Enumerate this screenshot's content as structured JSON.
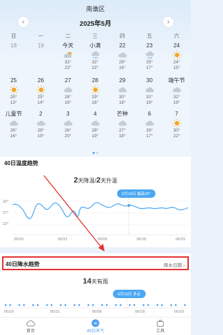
{
  "header": {
    "city": "南谯区",
    "month_title": "2025年5月",
    "prev": "‹",
    "next": "›"
  },
  "weekdays": [
    "日",
    "一",
    "二",
    "三",
    "四",
    "五",
    "六"
  ],
  "days": [
    {
      "d": "18",
      "hi": "",
      "lo": "",
      "icon": "none",
      "past": true
    },
    {
      "d": "19",
      "hi": "",
      "lo": "",
      "icon": "none",
      "past": true
    },
    {
      "d": "今天",
      "hi": "32°",
      "lo": "22°",
      "icon": "cloud-sun",
      "past": false
    },
    {
      "d": "小满",
      "hi": "32°",
      "lo": "22°",
      "icon": "rain",
      "past": false
    },
    {
      "d": "22",
      "hi": "29°",
      "lo": "16°",
      "icon": "cloud",
      "past": false
    },
    {
      "d": "23",
      "hi": "25°",
      "lo": "17°",
      "icon": "rain",
      "past": false
    },
    {
      "d": "24",
      "hi": "24°",
      "lo": "15°",
      "icon": "sun",
      "past": false
    },
    {
      "d": "25",
      "hi": "25°",
      "lo": "13°",
      "icon": "sun",
      "past": false
    },
    {
      "d": "26",
      "hi": "25°",
      "lo": "14°",
      "icon": "sun",
      "past": false
    },
    {
      "d": "27",
      "hi": "28°",
      "lo": "16°",
      "icon": "cloud",
      "past": false
    },
    {
      "d": "28",
      "hi": "29°",
      "lo": "16°",
      "icon": "sun",
      "past": false
    },
    {
      "d": "29",
      "hi": "30°",
      "lo": "18°",
      "icon": "cloud",
      "past": false
    },
    {
      "d": "30",
      "hi": "31°",
      "lo": "19°",
      "icon": "cloud",
      "past": false
    },
    {
      "d": "端午节",
      "hi": "32°",
      "lo": "19°",
      "icon": "cloud",
      "past": false
    },
    {
      "d": "儿童节",
      "hi": "26°",
      "lo": "16°",
      "icon": "cloud",
      "past": false
    },
    {
      "d": "2",
      "hi": "29°",
      "lo": "19°",
      "icon": "cloud",
      "past": false
    },
    {
      "d": "3",
      "hi": "26°",
      "lo": "20°",
      "icon": "cloud",
      "past": false
    },
    {
      "d": "4",
      "hi": "28°",
      "lo": "19°",
      "icon": "cloud",
      "past": false
    },
    {
      "d": "芒种",
      "hi": "27°",
      "lo": "18°",
      "icon": "cloud",
      "past": false
    },
    {
      "d": "6",
      "hi": "29°",
      "lo": "17°",
      "icon": "cloud",
      "past": false
    },
    {
      "d": "7",
      "hi": "30°",
      "lo": "22°",
      "icon": "sun",
      "past": false
    }
  ],
  "temp_section": {
    "title": "40日温度趋势",
    "summary_num1": "2",
    "summary_text1": "天降温/",
    "summary_num2": "2",
    "summary_text2": "天升温",
    "tooltip": "6月16日 最高29°",
    "y_labels": [
      "32°",
      "27°",
      "22°"
    ],
    "x_labels": [
      "05/20",
      "05/31",
      "06/08",
      "06/18",
      "06/29"
    ]
  },
  "rain_section": {
    "title": "40日降水趋势",
    "link": "降水日期 ›",
    "summary_num": "14",
    "summary_text": "天有雨",
    "tooltip": "6月19日 多云",
    "x_labels": [
      "05/20",
      "05/31",
      "06/08",
      "06/18",
      "06/29"
    ]
  },
  "tabbar": [
    {
      "label": "首页",
      "icon": "cloud-icon",
      "active": false
    },
    {
      "label": "40日天气",
      "icon": "calendar-40-icon",
      "active": true
    },
    {
      "label": "工具",
      "icon": "toolbox-icon",
      "active": false
    }
  ],
  "colors": {
    "accent": "#4a9ff0",
    "highlight": "#e53030",
    "sun": "#f5a623"
  }
}
